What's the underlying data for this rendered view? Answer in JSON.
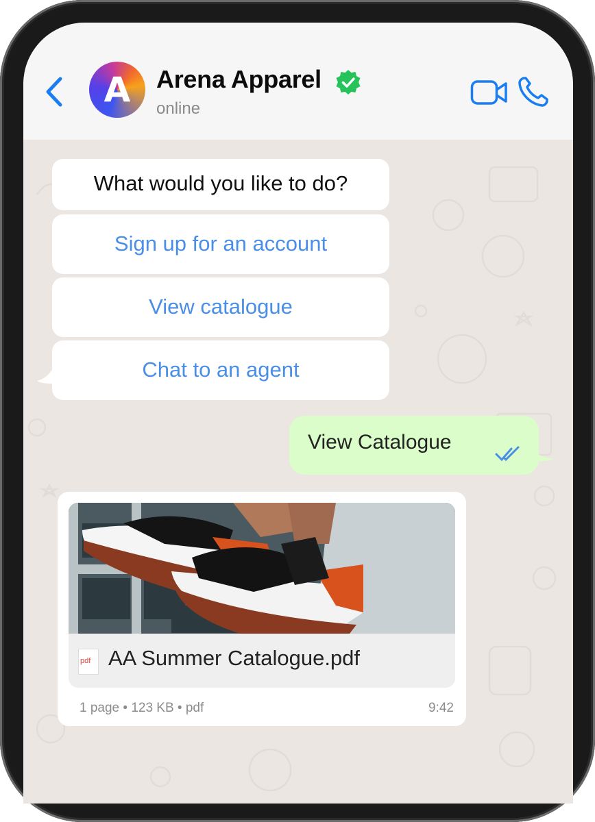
{
  "header": {
    "title": "Arena Apparel",
    "status": "online",
    "avatar_letter": "A",
    "verified": true,
    "icons": [
      "back-chevron-icon",
      "verified-badge-icon",
      "video-call-icon",
      "phone-call-icon"
    ]
  },
  "colors": {
    "accent": "#1a7ef0",
    "link": "#4a8ee6",
    "verified": "#25c35a",
    "outgoing_bubble": "#dbfdca",
    "chat_bg": "#ebe6e1",
    "header_bg": "#f6f6f6"
  },
  "messages": {
    "incoming_prompt": "What would you like to do?",
    "options": [
      {
        "label": "Sign up for an account"
      },
      {
        "label": "View catalogue"
      },
      {
        "label": "Chat to an agent"
      }
    ],
    "outgoing": {
      "text": "View Catalogue",
      "status": "read"
    },
    "file": {
      "type_icon": "pdf",
      "name": "AA Summer Catalogue.pdf",
      "meta": "1 page • 123 KB • pdf",
      "time": "9:42",
      "image_description": "sneakers photo"
    }
  }
}
